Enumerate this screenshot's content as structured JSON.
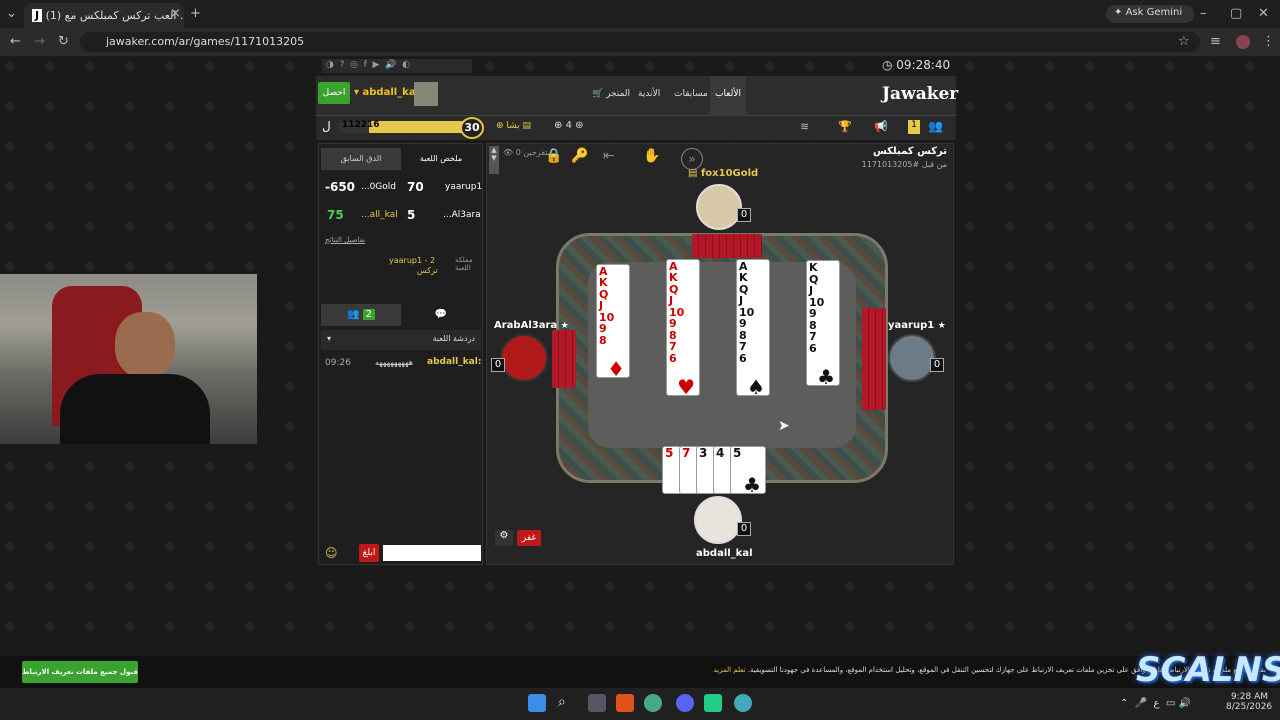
{
  "browser": {
    "tab_title": "(1) العب تركس كمبلكس مع ...",
    "tab_favicon": "J",
    "url": "jawaker.com/ar/games/1171013205",
    "ask_gemini": "Ask Gemini"
  },
  "site": {
    "clock": "09:28:40",
    "logo": "Jawaker",
    "nav": [
      "الألعاب",
      "مسابقات",
      "الأندية",
      "المتجر"
    ],
    "username": "abdall_kal",
    "get_button": "احصل",
    "xp_value": "112216",
    "level": "30",
    "gold_label": "بشا",
    "stars": "4",
    "notif_count": "1"
  },
  "game": {
    "title": "تركس كمبلكس",
    "game_id": "#1171013205",
    "time_ago": "من قبل",
    "spectators": "0 متفرجين",
    "left_tabs": [
      "ملخص اللعبة",
      "الدق السابق"
    ],
    "scores": [
      {
        "p1": "yaarup1",
        "s1": "70",
        "p2": "...0Gold",
        "s2": "-650"
      },
      {
        "p1": "...Al3ara",
        "s1": "5",
        "p2": "...all_kal",
        "s2": "75"
      }
    ],
    "details_link": "تفاصيل النتائج",
    "kingdom_label": "مملكة اللعبة",
    "kingdom_value": "yaarup1 - 2",
    "kingdom_game": "تركس",
    "chat_tabs_count": "2",
    "chat_header": "دردشة اللعبة",
    "chat_time": "09:26",
    "chat_user": "abdall_kal:",
    "chat_msg": "هههههههههه",
    "send_button": "ابلغ",
    "players": {
      "top": {
        "name": "fox10Gold",
        "score": "0"
      },
      "left": {
        "name": "ArabAl3ara",
        "score": "0"
      },
      "right": {
        "name": "yaarup1",
        "score": "0"
      },
      "bottom": {
        "name": "abdall_kal",
        "score": "0"
      }
    },
    "columns": [
      {
        "suit": "♦",
        "color": "red",
        "ranks": [
          "A",
          "K",
          "Q",
          "J",
          "10",
          "9",
          "8"
        ]
      },
      {
        "suit": "♥",
        "color": "red",
        "ranks": [
          "A",
          "K",
          "Q",
          "J",
          "10",
          "9",
          "8",
          "7",
          "6"
        ]
      },
      {
        "suit": "♠",
        "color": "black",
        "ranks": [
          "A",
          "K",
          "Q",
          "J",
          "10",
          "9",
          "8",
          "7",
          "6"
        ]
      },
      {
        "suit": "♣",
        "color": "black",
        "ranks": [
          "K",
          "Q",
          "J",
          "10",
          "9",
          "8",
          "7",
          "6"
        ]
      }
    ],
    "hand": [
      {
        "rank": "5",
        "color": "red"
      },
      {
        "rank": "7",
        "color": "red"
      },
      {
        "rank": "3",
        "color": "black"
      },
      {
        "rank": "4",
        "color": "black"
      },
      {
        "rank": "5",
        "color": "black",
        "suit": "♣"
      }
    ],
    "quit_button": "غفر"
  },
  "cookie": {
    "text": "بقبول جميع ملفات تعريف الارتباط، فإنك توافق على تخزين ملفات تعريف الارتباط على جهازك لتحسين التنقل في الموقع، وتحليل استخدام الموقع، والمساعدة في جهودنا التسويقية.",
    "learn_more": "تعلم المزيد",
    "accept_button": "قبول جميع ملفات تعريف الارتباط"
  },
  "watermark": "SCALNS",
  "taskbar": {
    "time": "9:28 AM",
    "date": "8/25/2026",
    "lang": "ع"
  }
}
